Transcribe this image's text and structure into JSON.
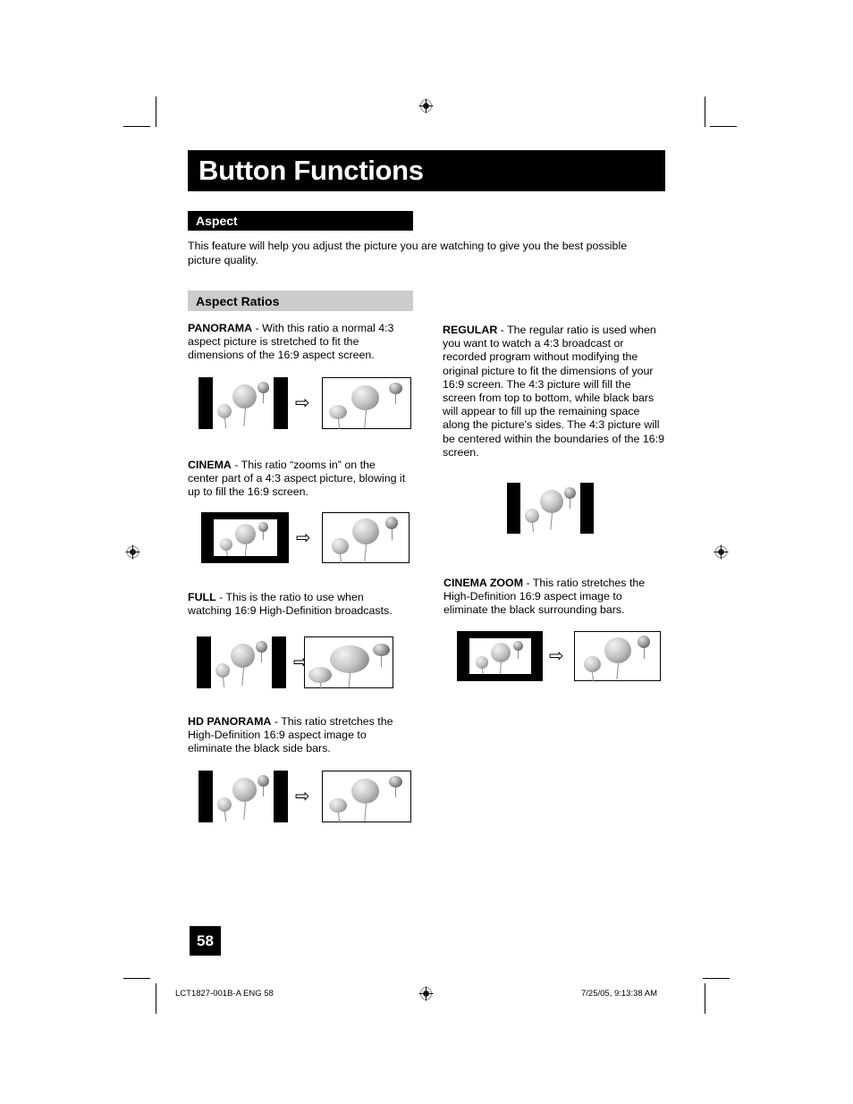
{
  "document": {
    "title": "Button Functions",
    "page_number": "58"
  },
  "sections": {
    "aspect": {
      "heading": "Aspect",
      "intro": "This feature will help you adjust the picture you are watching to give you the best possible picture quality."
    },
    "aspect_ratios": {
      "heading": "Aspect Ratios"
    }
  },
  "ratios": [
    {
      "id": "panorama",
      "name": "PANORAMA",
      "separator": " - ",
      "description": "With this ratio a normal 4:3 aspect picture is stretched to fit the dimensions of the 16:9 aspect screen.",
      "diagram": "before-after",
      "before_label": "4:3 picture with black side bars",
      "after_label": "16:9 stretched picture"
    },
    {
      "id": "cinema",
      "name": "CINEMA",
      "separator": " - ",
      "description": "This ratio “zooms in” on the center part of a 4:3 aspect picture, blowing it up to fill the 16:9 screen.",
      "diagram": "before-after",
      "before_label": "4:3 picture with black surrounding bars",
      "after_label": "16:9 zoomed picture"
    },
    {
      "id": "full",
      "name": "FULL",
      "separator": " - ",
      "description": "This is the ratio to use when watching 16:9 High-Definition broadcasts.",
      "diagram": "before-after",
      "before_label": "4:3 picture with black side bars",
      "after_label": "16:9 full picture"
    },
    {
      "id": "hd-panorama",
      "name": "HD PANORAMA",
      "separator": " - ",
      "description": "This ratio stretches the High-Definition 16:9 aspect image to eliminate the black side bars.",
      "diagram": "before-after",
      "before_label": "16:9 picture with black side bars",
      "after_label": "16:9 stretched picture"
    },
    {
      "id": "regular",
      "name": "REGULAR",
      "separator": " - ",
      "description": "The regular ratio is used when you want to watch a 4:3 broadcast or recorded program without modifying the original picture to fit the dimensions of your 16:9 screen. The 4:3 picture will fill the screen from top to bottom, while black bars will appear to fill up the remaining space along the picture's sides. The 4:3 picture will be centered within the boundaries of the 16:9 screen.",
      "diagram": "single",
      "before_label": "4:3 picture centered with black side bars"
    },
    {
      "id": "cinema-zoom",
      "name": "CINEMA ZOOM",
      "separator": " - ",
      "description": "This ratio stretches the High-Definition 16:9 aspect image to eliminate the black surrounding bars.",
      "diagram": "before-after",
      "before_label": "16:9 picture with black surrounding bars",
      "after_label": "16:9 zoomed picture"
    }
  ],
  "icons": {
    "transition_arrow": "⇨",
    "registration_target": "registration-target-icon"
  },
  "footer": {
    "left": "LCT1827-001B-A ENG   58",
    "right": "7/25/05, 9:13:38 AM"
  },
  "colors": {
    "banner_background": "#000000",
    "banner_text": "#ffffff",
    "subheading_background": "#cccccc",
    "page_background": "#ffffff",
    "body_text": "#000000"
  }
}
